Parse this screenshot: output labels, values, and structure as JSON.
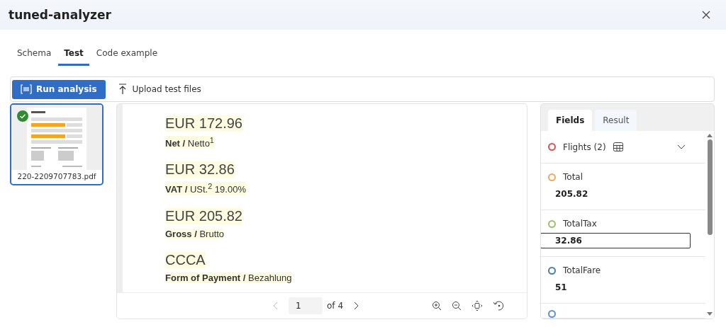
{
  "window": {
    "title": "tuned-analyzer"
  },
  "tabs": [
    {
      "label": "Schema",
      "selected": false
    },
    {
      "label": "Test",
      "selected": true
    },
    {
      "label": "Code example",
      "selected": false
    }
  ],
  "toolbar": {
    "run_button": "Run analysis",
    "upload_button": "Upload test files"
  },
  "files": [
    {
      "name": "220-2209707783.pdf",
      "selected": true,
      "analyzed": true
    }
  ],
  "document": {
    "lines": [
      {
        "amount": "EUR 172.96",
        "label": "**Net /** Netto$^{1}$"
      },
      {
        "amount": "EUR 32.86",
        "label": "**VAT /** USt.$^{2}$ 19.00%"
      },
      {
        "amount": "EUR 205.82",
        "label": "**Gross /** Brutto"
      },
      {
        "amount": "CCCA",
        "label": "**Form of Payment /** Bezahlung"
      }
    ],
    "pager": {
      "page": "1",
      "total": "of 4"
    }
  },
  "panel_tabs": [
    {
      "label": "Fields",
      "selected": true
    },
    {
      "label": "Result",
      "selected": false
    }
  ],
  "fields": [
    {
      "kind": "table",
      "name": "Flights (2)",
      "color": "#d9534f",
      "expanded": false
    },
    {
      "kind": "value",
      "name": "Total",
      "value": "205.82",
      "color": "#f0a860",
      "selected": false
    },
    {
      "kind": "value",
      "name": "TotalTax",
      "value": "32.86",
      "color": "#9cc06a",
      "selected": true
    },
    {
      "kind": "value",
      "name": "TotalFare",
      "value": "51",
      "color": "#4a7fa8",
      "selected": false
    },
    {
      "kind": "cut",
      "color": "#5b8fd8"
    }
  ]
}
